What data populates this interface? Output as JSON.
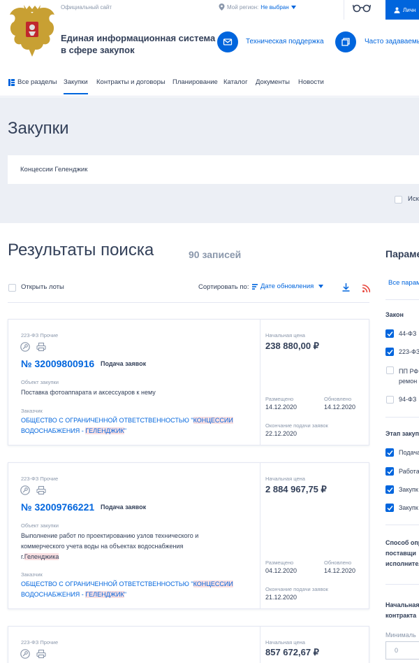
{
  "header": {
    "official_site": "Официальный сайт",
    "region_label": "Мой регион:",
    "region_value": "Не выбран",
    "site_name_line1": "Единая информационная система",
    "site_name_line2": "в сфере закупок",
    "support_label": "Техническая поддержка",
    "faq_label": "Часто задаваемы",
    "login_label": "Личн"
  },
  "nav": {
    "items": [
      "Все разделы",
      "Закупки",
      "Контракты и договоры",
      "Планирование",
      "Каталог",
      "Документы",
      "Новости"
    ],
    "active": "Закупки"
  },
  "search": {
    "title": "Закупки",
    "query": "Концессии Геленджик",
    "option_partial": "Иск"
  },
  "results": {
    "title": "Результаты поиска",
    "count": "90 записей",
    "open_lots": "Открыть лоты",
    "sort_label": "Сортировать по:",
    "sort_value": "Дате обновления"
  },
  "cards": [
    {
      "law": "223-ФЗ Прочие",
      "number": "№ 32009800916",
      "stage": "Подача заявок",
      "object_label": "Объект закупки",
      "object_lines": [
        "Поставка фотоаппарата и аксессуаров к нему"
      ],
      "customer_label": "Заказчик",
      "customer_line1_a": "ОБЩЕСТВО С ОГРАНИЧЕННОЙ ОТВЕТСТВЕННОСТЬЮ \"",
      "customer_line1_hl": "КОНЦЕССИИ",
      "customer_line2_a": "ВОДОСНАБЖЕНИЯ - ",
      "customer_line2_hl": "ГЕЛЕНДЖИК",
      "customer_line2_b": "\"",
      "price_label": "Начальная цена",
      "price": "238 880,00 ₽",
      "placed_label": "Размещено",
      "placed": "14.12.2020",
      "updated_label": "Обновлено",
      "updated": "14.12.2020",
      "end_label": "Окончание подачи заявок",
      "end": "22.12.2020"
    },
    {
      "law": "223-ФЗ Прочие",
      "number": "№ 32009766221",
      "stage": "Подача заявок",
      "object_label": "Объект закупки",
      "object_lines": [
        "Выполнение работ по проектированию узлов технического и",
        "коммерческого учета воды на объектах водоснабжения"
      ],
      "object_line3_a": "г.",
      "object_line3_hl": "Геленджика",
      "customer_label": "Заказчик",
      "customer_line1_a": "ОБЩЕСТВО С ОГРАНИЧЕННОЙ ОТВЕТСТВЕННОСТЬЮ \"",
      "customer_line1_hl": "КОНЦЕССИИ",
      "customer_line2_a": "ВОДОСНАБЖЕНИЯ - ",
      "customer_line2_hl": "ГЕЛЕНДЖИК",
      "customer_line2_b": "\"",
      "price_label": "Начальная цена",
      "price": "2 884 967,75 ₽",
      "placed_label": "Размещено",
      "placed": "04.12.2020",
      "updated_label": "Обновлено",
      "updated": "14.12.2020",
      "end_label": "Окончание подачи заявок",
      "end": "21.12.2020"
    },
    {
      "law": "223-ФЗ Прочие",
      "price_label": "Начальная цена",
      "price": "857 672,67 ₽"
    }
  ],
  "sidebar": {
    "title": "Параме",
    "all_params": "Все парам",
    "law_title": "Закон",
    "law_items": [
      "44-ФЗ",
      "223-ФЗ",
      "ПП РФ",
      "ремон",
      "94-ФЗ"
    ],
    "stage_title": "Этап закуп",
    "stage_items": [
      "Подача",
      "Работа",
      "Закупк",
      "Закупк"
    ],
    "method_title_lines": [
      "Способ опр",
      "поставщи",
      "исполнител"
    ],
    "price_title_lines": [
      "Начальная",
      "контракта"
    ],
    "min_label": "Минималь",
    "min_value": "0"
  },
  "colors": {
    "accent": "#0065dd",
    "text": "#334059",
    "muted": "#8a97ab",
    "highlight": "#fbe0e2",
    "band": "#eceff5"
  }
}
